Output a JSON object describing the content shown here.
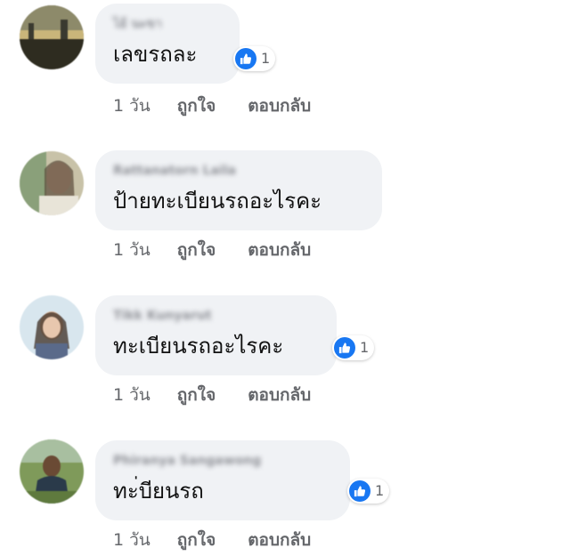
{
  "comments": [
    {
      "author": "ไอ้ นะขา",
      "text": "เลขรถละ",
      "reaction_count": "1",
      "time": "1 วัน",
      "like_label": "ถูกใจ",
      "reply_label": "ตอบกลับ"
    },
    {
      "author": "Rattanatorn Laila",
      "text": "ป้ายทะเบียนรถอะไรคะ",
      "time": "1 วัน",
      "like_label": "ถูกใจ",
      "reply_label": "ตอบกลับ"
    },
    {
      "author": "Tikk Kunyarut",
      "text": "ทะเบียนรถอะไรคะ",
      "reaction_count": "1",
      "time": "1 วัน",
      "like_label": "ถูกใจ",
      "reply_label": "ตอบกลับ"
    },
    {
      "author": "Phiranya Sangawong",
      "text": "ทะ่บียนรถ",
      "reaction_count": "1",
      "time": "1 วัน",
      "like_label": "ถูกใจ",
      "reply_label": "ตอบกลับ"
    }
  ],
  "reaction_icon": "thumbs-up-icon",
  "colors": {
    "like_blue": "#1877f2",
    "bubble_bg": "#f0f2f5",
    "muted_text": "#65676b"
  }
}
